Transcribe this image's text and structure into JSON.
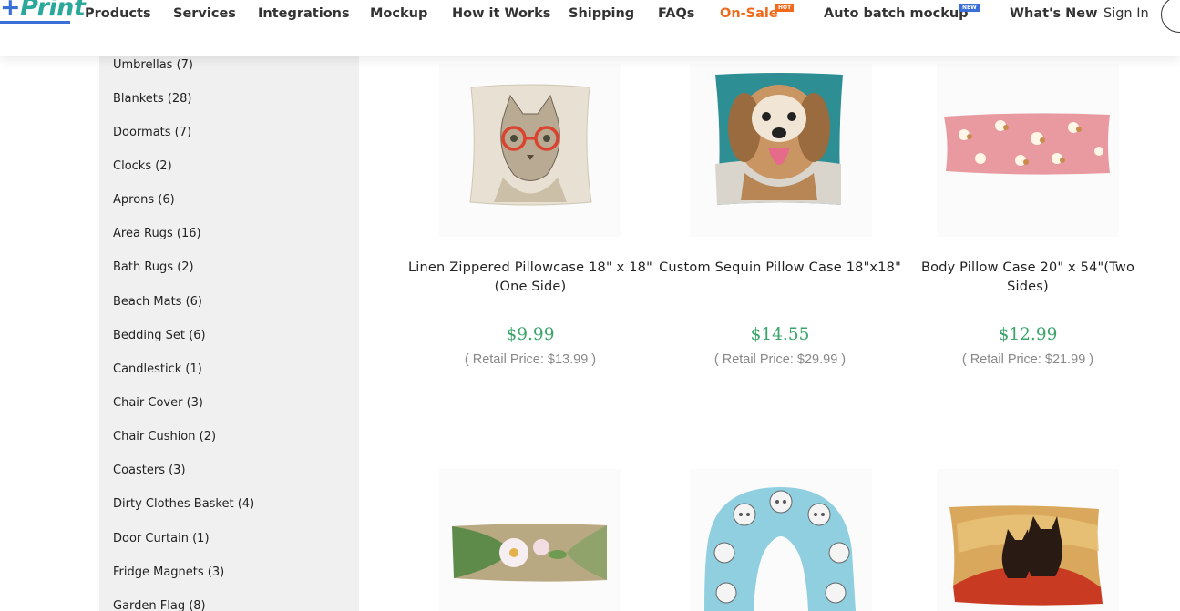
{
  "header": {
    "logo": "Print",
    "nav": [
      {
        "label": "Products"
      },
      {
        "label": "Services"
      },
      {
        "label": "Integrations"
      },
      {
        "label": "Mockup"
      },
      {
        "label": "How it Works"
      },
      {
        "label": "Shipping"
      },
      {
        "label": "FAQs"
      },
      {
        "label": "On-Sale",
        "badge": "HOT"
      },
      {
        "label": "Auto batch mockup",
        "badge": "NEW"
      },
      {
        "label": "What's New"
      }
    ],
    "signin": "Sign In"
  },
  "sidebar": {
    "categories": [
      "Umbrellas (7)",
      "Blankets (28)",
      "Doormats (7)",
      "Clocks (2)",
      "Aprons (6)",
      "Area Rugs (16)",
      "Bath Rugs (2)",
      "Beach Mats (6)",
      "Bedding Set (6)",
      "Candlestick (1)",
      "Chair Cover (3)",
      "Chair Cushion (2)",
      "Coasters (3)",
      "Dirty Clothes Basket (4)",
      "Door Curtain (1)",
      "Fridge Magnets (3)",
      "Garden Flag (8)"
    ]
  },
  "products": [
    {
      "title": "Linen Zippered Pillowcase 18\" x 18\" (One Side)",
      "price": "$9.99",
      "retail": "( Retail Price: $13.99 )"
    },
    {
      "title": "Custom Sequin Pillow Case 18\"x18\"",
      "price": "$14.55",
      "retail": "( Retail Price: $29.99 )"
    },
    {
      "title": "Body Pillow Case 20\" x 54\"(Two Sides)",
      "price": "$12.99",
      "retail": "( Retail Price: $21.99 )"
    },
    {
      "title": "",
      "price": "",
      "retail": ""
    },
    {
      "title": "",
      "price": "",
      "retail": ""
    },
    {
      "title": "",
      "price": "",
      "retail": ""
    }
  ],
  "colors": {
    "accent": "#2aa89a",
    "sale": "#f06a1c",
    "price": "#3aa46a",
    "new_badge": "#3b6fd8"
  }
}
